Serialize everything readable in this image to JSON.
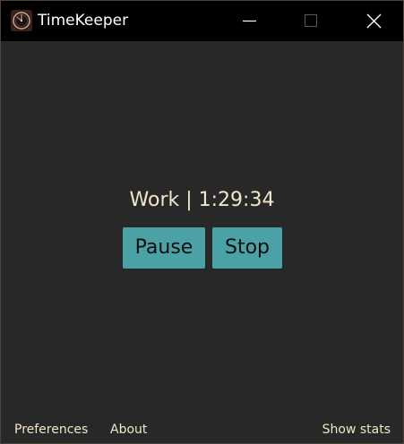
{
  "window": {
    "title": "TimeKeeper",
    "icon": "clock-icon"
  },
  "titlebar_controls": {
    "minimize_icon": "minimize-icon",
    "maximize_icon": "maximize-icon",
    "close_icon": "close-icon"
  },
  "timer": {
    "status": "Work | 1:29:34"
  },
  "controls": {
    "pause_label": "Pause",
    "stop_label": "Stop"
  },
  "footer": {
    "preferences_label": "Preferences",
    "about_label": "About",
    "show_stats_label": "Show stats"
  },
  "colors": {
    "background": "#282828",
    "titlebar": "#000000",
    "text": "#f0e6c8",
    "button": "#4ba2a6"
  }
}
